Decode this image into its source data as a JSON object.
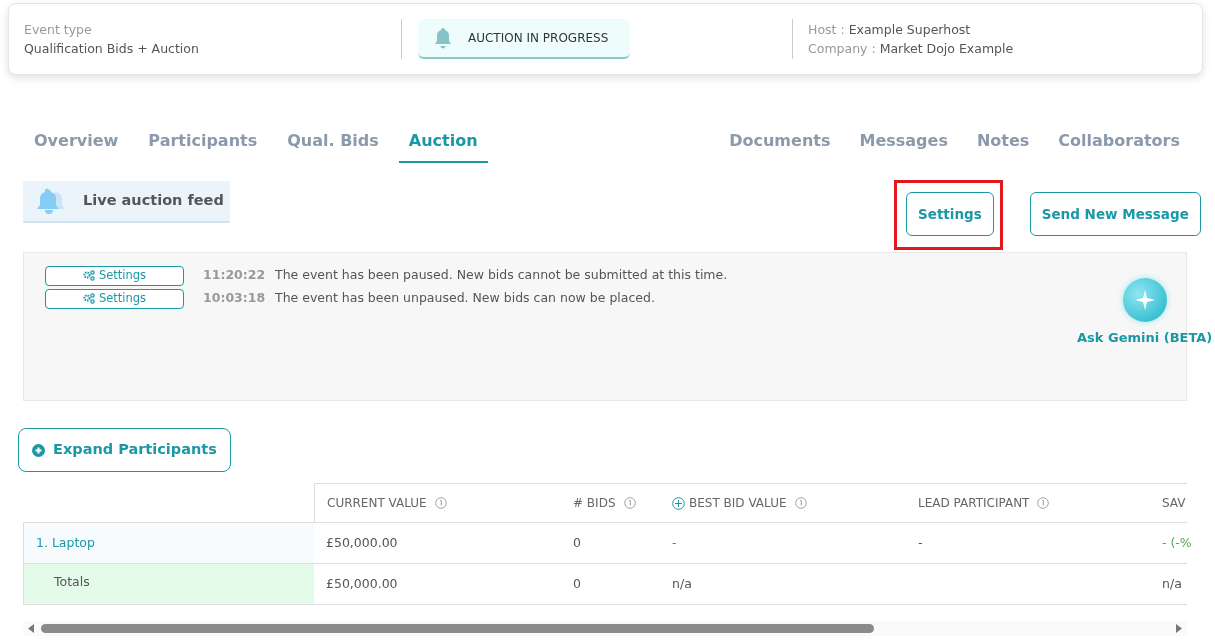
{
  "header": {
    "event_type_label": "Event type",
    "event_type": "Qualification Bids + Auction",
    "status": "AUCTION IN PROGRESS",
    "host_label": "Host :",
    "host": "Example Superhost",
    "company_label": "Company :",
    "company": "Market Dojo Example"
  },
  "tabs_left": [
    {
      "label": "Overview",
      "selected": false
    },
    {
      "label": "Participants",
      "selected": false
    },
    {
      "label": "Qual. Bids",
      "selected": false
    },
    {
      "label": "Auction",
      "selected": true
    }
  ],
  "tabs_right": [
    {
      "label": "Documents",
      "selected": false
    },
    {
      "label": "Messages",
      "selected": false
    },
    {
      "label": "Notes",
      "selected": false
    },
    {
      "label": "Collaborators",
      "selected": false
    }
  ],
  "feed": {
    "title": "Live auction feed",
    "entries": [
      {
        "button": "Settings",
        "time": "11:20:22",
        "message": "The event has been paused. New bids cannot be submitted at this time."
      },
      {
        "button": "Settings",
        "time": "10:03:18",
        "message": "The event has been unpaused. New bids can now be placed."
      }
    ],
    "assistant": "Ask Gemini (BETA)"
  },
  "actions": [
    {
      "label": "Settings",
      "highlighted": true
    },
    {
      "label": "Send New Message",
      "highlighted": false
    }
  ],
  "expand_button": "Expand Participants",
  "table": {
    "columns": [
      {
        "label": "CURRENT VALUE",
        "expandable": false
      },
      {
        "label": "# BIDS",
        "expandable": false
      },
      {
        "label": "BEST BID VALUE",
        "expandable": true
      },
      {
        "label": "LEAD PARTICIPANT",
        "expandable": false
      },
      {
        "label": "SAV",
        "expandable": false
      }
    ],
    "rows": [
      {
        "kind": "lot",
        "name": "1. Laptop",
        "cells": [
          "£50,000.00",
          "0",
          "-",
          "-",
          "- (-%"
        ]
      },
      {
        "kind": "total",
        "name": "Totals",
        "cells": [
          "£50,000.00",
          "0",
          "n/a",
          "",
          "n/a"
        ]
      }
    ]
  }
}
